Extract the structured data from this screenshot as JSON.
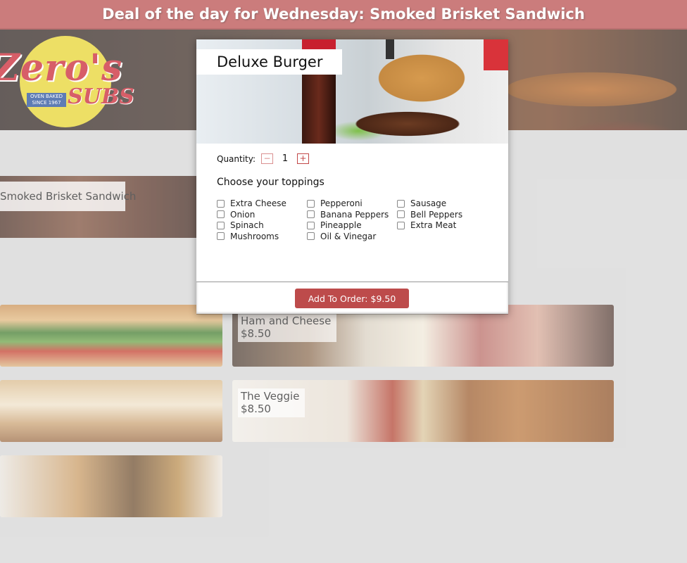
{
  "banner": {
    "text": "Deal of the day for Wednesday: Smoked Brisket Sandwich"
  },
  "logo": {
    "word": "Zero's",
    "subs": "SUBS",
    "stamp_line1": "OVEN BAKED",
    "stamp_line2": "SINCE 1967"
  },
  "deal_card": {
    "label": "Smoked Brisket Sandwich"
  },
  "menu": [
    {
      "name": "",
      "price": ""
    },
    {
      "name": "Ham and Cheese",
      "price": "$8.50"
    },
    {
      "name": "",
      "price": ""
    },
    {
      "name": "The Veggie",
      "price": "$8.50"
    },
    {
      "name": "",
      "price": ""
    }
  ],
  "modal": {
    "title": "Deluxe Burger",
    "quantity_label": "Quantity:",
    "quantity_minus": "−",
    "quantity_value": "1",
    "quantity_plus": "+",
    "toppings_title": "Choose your toppings",
    "toppings": [
      "Extra Cheese",
      "Pepperoni",
      "Sausage",
      "Onion",
      "Banana Peppers",
      "Bell Peppers",
      "Spinach",
      "Pineapple",
      "Extra Meat",
      "Mushrooms",
      "Oil & Vinegar"
    ],
    "add_button": "Add To Order: $9.50"
  },
  "colors": {
    "brand_red": "#bd4b4b",
    "banner_red": "#b84a4a",
    "logo_yellow": "#e7d32a"
  }
}
